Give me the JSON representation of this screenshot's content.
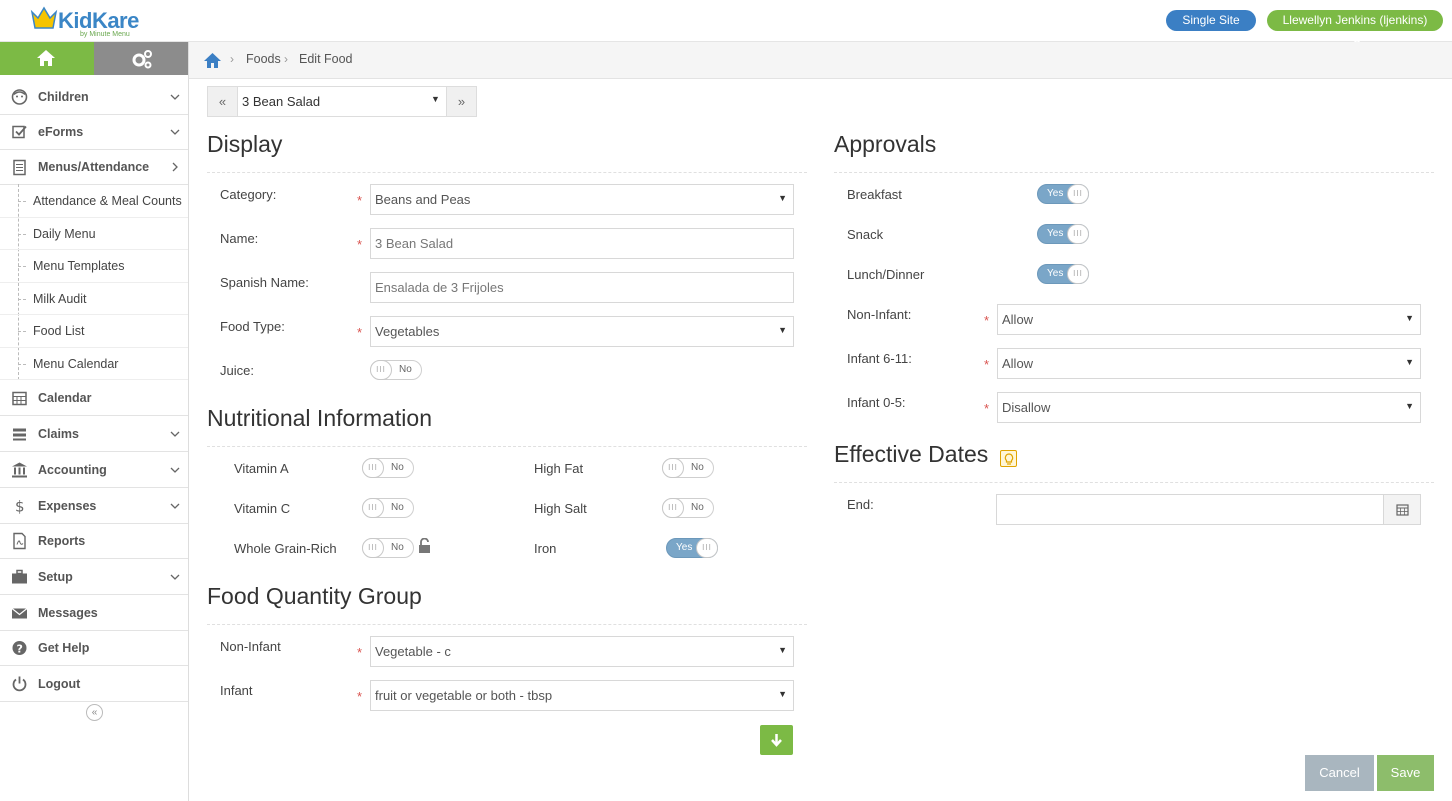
{
  "header": {
    "brand": "KidKare",
    "brand_sub": "by Minute Menu",
    "site_button": "Single Site",
    "user_button": "Llewellyn Jenkins (ljenkins)"
  },
  "sidebar": {
    "items": [
      {
        "label": "Children",
        "icon": "child-face-icon"
      },
      {
        "label": "eForms",
        "icon": "checkbox-icon"
      },
      {
        "label": "Menus/Attendance",
        "icon": "clipboard-icon"
      },
      {
        "label": "Calendar",
        "icon": "calendar-icon"
      },
      {
        "label": "Claims",
        "icon": "list-icon"
      },
      {
        "label": "Accounting",
        "icon": "bank-icon"
      },
      {
        "label": "Expenses",
        "icon": "dollar-icon"
      },
      {
        "label": "Reports",
        "icon": "pdf-icon"
      },
      {
        "label": "Setup",
        "icon": "briefcase-icon"
      },
      {
        "label": "Messages",
        "icon": "envelope-icon"
      },
      {
        "label": "Get Help",
        "icon": "question-icon"
      },
      {
        "label": "Logout",
        "icon": "power-icon"
      }
    ],
    "sub_items": [
      "Attendance & Meal Counts",
      "Daily Menu",
      "Menu Templates",
      "Milk Audit",
      "Food List",
      "Menu Calendar"
    ]
  },
  "breadcrumb": {
    "items": [
      "Foods",
      "Edit Food"
    ]
  },
  "food_nav": {
    "selected": "3 Bean Salad"
  },
  "display": {
    "title": "Display",
    "category_label": "Category:",
    "category_value": "Beans and Peas",
    "name_label": "Name:",
    "name_value": "3 Bean Salad",
    "spanish_label": "Spanish Name:",
    "spanish_placeholder": "Ensalada de 3 Frijoles",
    "food_type_label": "Food Type:",
    "food_type_value": "Vegetables",
    "juice_label": "Juice:"
  },
  "nutrition": {
    "title": "Nutritional Information",
    "vitamin_a": "Vitamin A",
    "vitamin_c": "Vitamin C",
    "whole_grain": "Whole Grain-Rich",
    "high_fat": "High Fat",
    "high_salt": "High Salt",
    "iron": "Iron"
  },
  "quantity": {
    "title": "Food Quantity Group",
    "non_infant_label": "Non-Infant",
    "non_infant_value": "Vegetable - c",
    "infant_label": "Infant",
    "infant_value": "fruit or vegetable or both - tbsp"
  },
  "approvals": {
    "title": "Approvals",
    "breakfast": "Breakfast",
    "snack": "Snack",
    "lunch": "Lunch/Dinner",
    "non_infant_label": "Non-Infant:",
    "non_infant_value": "Allow",
    "infant611_label": "Infant 6-11:",
    "infant611_value": "Allow",
    "infant05_label": "Infant 0-5:",
    "infant05_value": "Disallow"
  },
  "effective": {
    "title": "Effective Dates",
    "end_label": "End:"
  },
  "toggles": {
    "yes": "Yes",
    "no": "No",
    "knob": "III"
  },
  "buttons": {
    "cancel": "Cancel",
    "save": "Save"
  },
  "colors": {
    "green": "#7cba45",
    "blue": "#3b7fc4",
    "toggle_on": "#7aa6c8"
  }
}
